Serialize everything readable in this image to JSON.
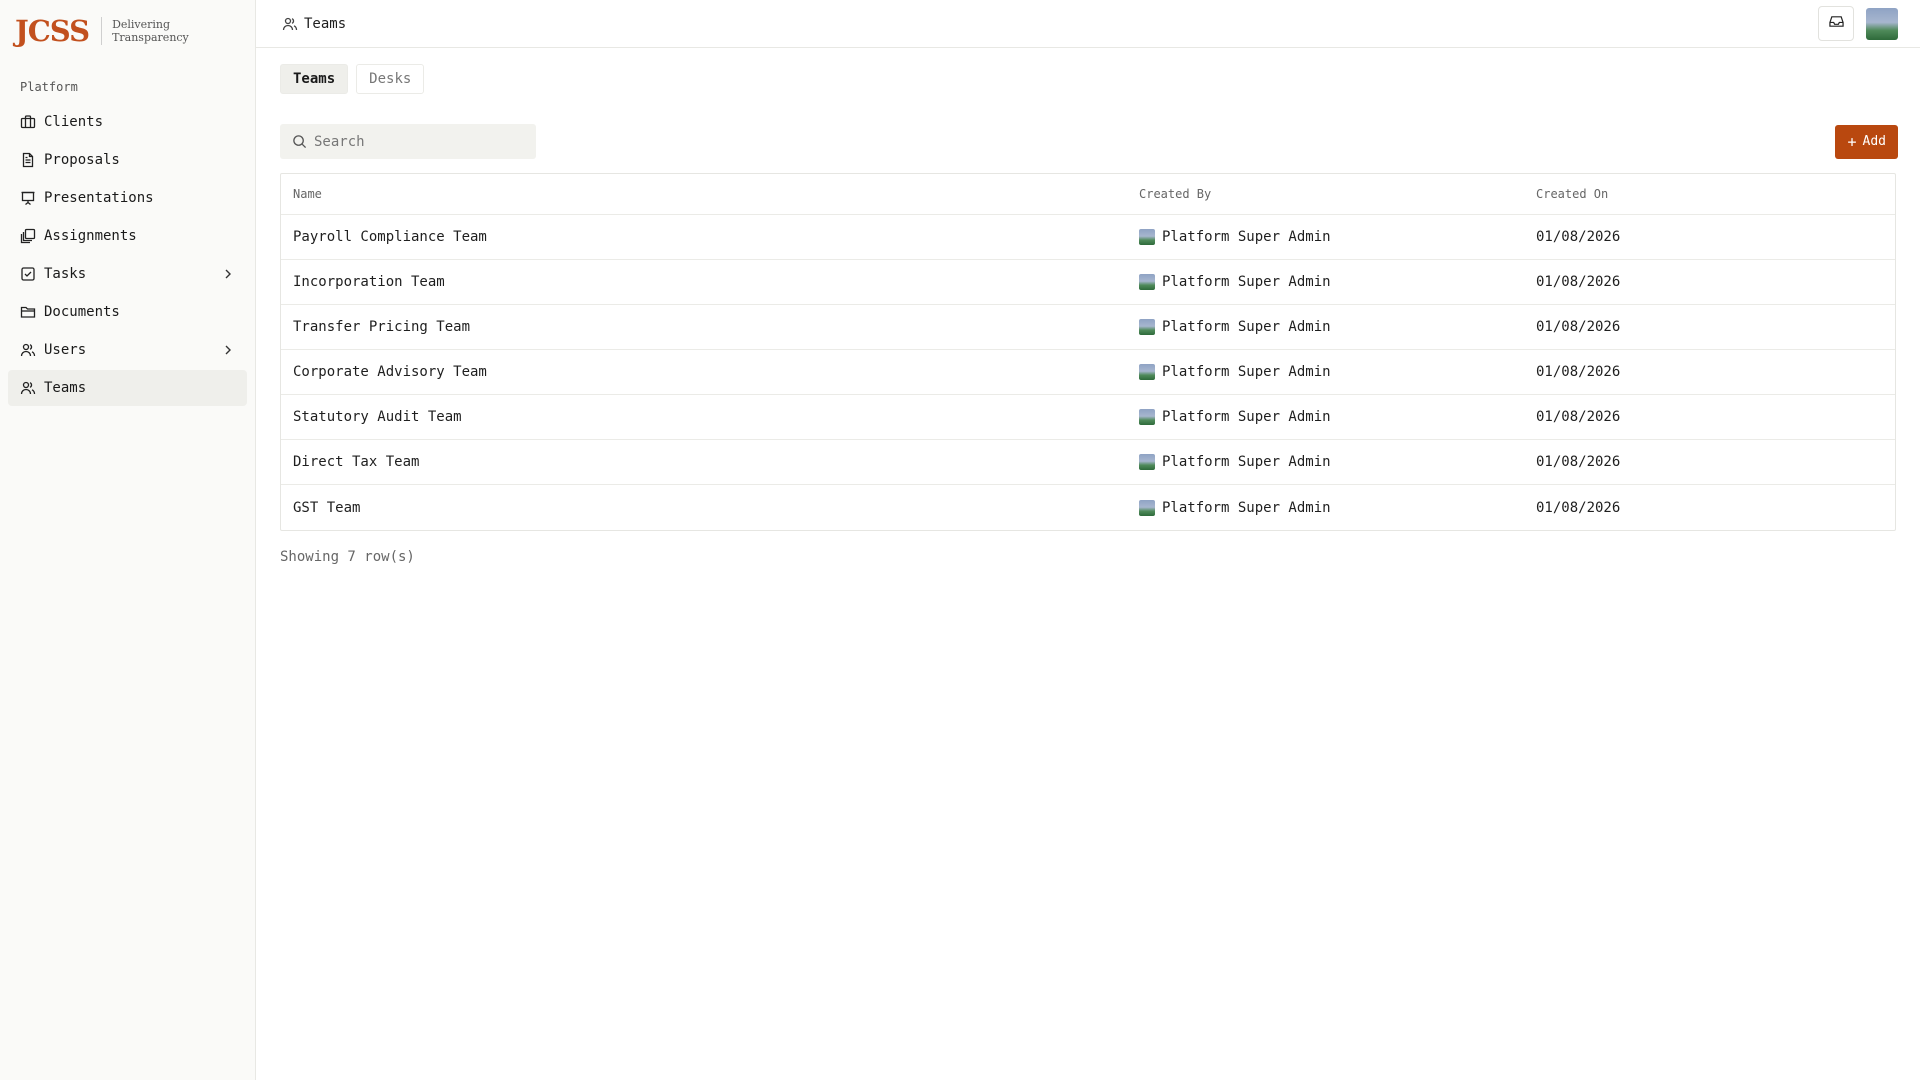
{
  "brand": {
    "logo": "JCSS",
    "tagline_1": "Delivering",
    "tagline_2": "Transparency"
  },
  "sidebar": {
    "section": "Platform",
    "items": [
      {
        "label": "Clients",
        "icon": "briefcase-icon"
      },
      {
        "label": "Proposals",
        "icon": "file-text-icon"
      },
      {
        "label": "Presentations",
        "icon": "presentation-icon"
      },
      {
        "label": "Assignments",
        "icon": "stack-icon"
      },
      {
        "label": "Tasks",
        "icon": "check-square-icon"
      },
      {
        "label": "Documents",
        "icon": "folder-icon"
      },
      {
        "label": "Users",
        "icon": "users-icon"
      },
      {
        "label": "Teams",
        "icon": "users-icon"
      }
    ]
  },
  "header": {
    "breadcrumb": "Teams"
  },
  "tabs": [
    {
      "label": "Teams"
    },
    {
      "label": "Desks"
    }
  ],
  "search": {
    "placeholder": "Search"
  },
  "toolbar": {
    "add_label": "Add"
  },
  "table": {
    "columns": [
      "Name",
      "Created By",
      "Created On"
    ],
    "rows": [
      {
        "name": "Payroll Compliance Team",
        "created_by": "Platform Super Admin",
        "created_on": "01/08/2026"
      },
      {
        "name": "Incorporation Team",
        "created_by": "Platform Super Admin",
        "created_on": "01/08/2026"
      },
      {
        "name": "Transfer Pricing Team",
        "created_by": "Platform Super Admin",
        "created_on": "01/08/2026"
      },
      {
        "name": "Corporate Advisory Team",
        "created_by": "Platform Super Admin",
        "created_on": "01/08/2026"
      },
      {
        "name": "Statutory Audit Team",
        "created_by": "Platform Super Admin",
        "created_on": "01/08/2026"
      },
      {
        "name": "Direct Tax Team",
        "created_by": "Platform Super Admin",
        "created_on": "01/08/2026"
      },
      {
        "name": "GST Team",
        "created_by": "Platform Super Admin",
        "created_on": "01/08/2026"
      }
    ]
  },
  "footer": {
    "row_count_text": "Showing 7 row(s)"
  },
  "colors": {
    "brand": "#c2501e",
    "accent": "#b9480f"
  }
}
